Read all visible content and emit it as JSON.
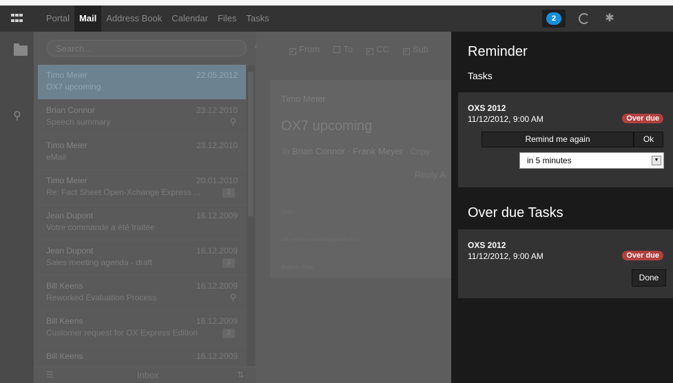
{
  "topbar": {
    "apps_icon": "grid-icon",
    "tabs": [
      {
        "label": "Portal",
        "active": false
      },
      {
        "label": "Mail",
        "active": true
      },
      {
        "label": "Address Book",
        "active": false
      },
      {
        "label": "Calendar",
        "active": false
      },
      {
        "label": "Files",
        "active": false
      },
      {
        "label": "Tasks",
        "active": false
      }
    ],
    "notification_count": "2",
    "refresh_icon": "refresh-icon",
    "settings_icon": "gear-icon"
  },
  "rail": {
    "icons": [
      "pencil-icon",
      "folder-icon",
      "search-icon"
    ]
  },
  "search": {
    "placeholder": "Search..."
  },
  "mail_list": [
    {
      "from": "Timo Meier",
      "date": "22.05.2012",
      "subject": "OX7 upcoming",
      "selected": true,
      "attachment": false,
      "count": ""
    },
    {
      "from": "Brian Connor",
      "date": "23.12.2010",
      "subject": "Speech summary",
      "selected": false,
      "attachment": true,
      "count": ""
    },
    {
      "from": "Timo Meier",
      "date": "23.12.2010",
      "subject": "eMail",
      "selected": false,
      "attachment": false,
      "count": ""
    },
    {
      "from": "Timo Meier",
      "date": "20.01.2010",
      "subject": "Re: Fact Sheet Open-Xchange Express ...",
      "selected": false,
      "attachment": false,
      "count": "2"
    },
    {
      "from": "Jean Dupont",
      "date": "16.12.2009",
      "subject": "Votre commande a été traitée",
      "selected": false,
      "attachment": false,
      "count": ""
    },
    {
      "from": "Jean Dupont",
      "date": "16.12.2009",
      "subject": "Sales meeting agenda - draft",
      "selected": false,
      "attachment": false,
      "count": "3"
    },
    {
      "from": "Bill Keens",
      "date": "16.12.2009",
      "subject": "Reworked Evaluation Process",
      "selected": false,
      "attachment": true,
      "count": ""
    },
    {
      "from": "Bill Keens",
      "date": "16.12.2009",
      "subject": "Customer request for OX Express Edition",
      "selected": false,
      "attachment": false,
      "count": "2"
    },
    {
      "from": "Bill Keens",
      "date": "16.12.2009",
      "subject": "",
      "selected": false,
      "attachment": false,
      "count": ""
    }
  ],
  "list_footer": {
    "folder": "Inbox"
  },
  "filters": [
    {
      "label": "From",
      "checked": true
    },
    {
      "label": "To",
      "checked": false
    },
    {
      "label": "CC",
      "checked": true
    },
    {
      "label": "Sub",
      "checked": true
    }
  ],
  "mail_detail": {
    "from": "Timo Meier",
    "subject": "OX7 upcoming",
    "to_label": "To",
    "to": "Brian Connor · Frank Meyer",
    "copy_label": "· Copy",
    "reply_label": "Reply A",
    "body": [
      "Hallo,",
      "did you hear something about this?",
      "Regards, Timo"
    ]
  },
  "reminder": {
    "title": "Reminder",
    "tasks_label": "Tasks",
    "task": {
      "title": "OXS 2012",
      "datetime": "11/12/2012, 9:00 AM",
      "status": "Over due",
      "remind_label": "Remind me again",
      "ok_label": "Ok",
      "interval_selected": "in 5 minutes"
    },
    "overdue_heading": "Over due Tasks",
    "overdue_task": {
      "title": "OXS 2012",
      "datetime": "11/12/2012, 9:00 AM",
      "status": "Over due",
      "done_label": "Done"
    },
    "colors": {
      "overdue": "#b0403e",
      "badge": "#1a8ed6"
    }
  }
}
